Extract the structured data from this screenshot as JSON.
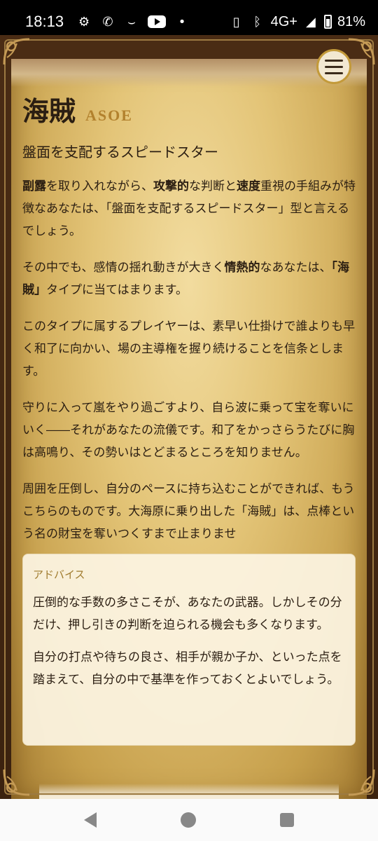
{
  "status_bar": {
    "time": "18:13",
    "network": "4G+",
    "battery": "81%",
    "battery_level": 0.81,
    "left_icons": [
      "gear-icon",
      "phone-wifi-icon",
      "amazon-icon",
      "youtube-icon",
      "dot-icon"
    ],
    "right_icons": [
      "nfc-icon",
      "bluetooth-icon",
      "signal-icon",
      "battery-icon"
    ]
  },
  "colors": {
    "frame": "#3b220f",
    "parchment": "#e3c477",
    "accent_gold": "#b2812d",
    "text": "#2b1e12",
    "advice_bg": "#fcf4e2"
  },
  "header": {
    "title": "海賊",
    "title_en": "ASOE",
    "tagline": "盤面を支配するスピードスター",
    "menu_icon": "hamburger-menu-icon"
  },
  "paragraphs": [
    [
      {
        "text": "副露",
        "bold": true
      },
      {
        "text": "を取り入れながら、",
        "bold": false
      },
      {
        "text": "攻撃的",
        "bold": true
      },
      {
        "text": "な判断と",
        "bold": false
      },
      {
        "text": "速度",
        "bold": true
      },
      {
        "text": "重視の手組みが特徴なあなたは、「盤面を支配するスピードスター」型と言えるでしょう。",
        "bold": false
      }
    ],
    [
      {
        "text": "その中でも、感情の揺れ動きが大きく",
        "bold": false
      },
      {
        "text": "情熱的",
        "bold": true
      },
      {
        "text": "なあなたは、",
        "bold": false
      },
      {
        "text": "「海賊」",
        "bold": true
      },
      {
        "text": "タイプに当てはまります。",
        "bold": false
      }
    ],
    [
      {
        "text": "このタイプに属するプレイヤーは、素早い仕掛けで誰よりも早く和了に向かい、場の主導権を握り続けることを信条とします。",
        "bold": false
      }
    ],
    [
      {
        "text": "守りに入って嵐をやり過ごすより、自ら波に乗って宝を奪いにいく――それがあなたの流儀です。和了をかっさらうたびに胸は高鳴り、その勢いはとどまるところを知りません。",
        "bold": false
      }
    ],
    [
      {
        "text": "周囲を圧倒し、自分のペースに持ち込むことができれば、もうこちらのものです。大海原に乗り出した「海賊」は、点棒という名の財宝を奪いつくすまで止まりませ",
        "bold": false
      }
    ]
  ],
  "advice": {
    "label": "アドバイス",
    "paragraphs": [
      "圧倒的な手数の多さこそが、あなたの武器。しかしその分だけ、押し引きの判断を迫られる機会も多くなります。",
      "自分の打点や待ちの良さ、相手が親か子か、といった点を踏まえて、自分の中で基準を作っておくとよいでしょう。"
    ]
  },
  "nav_bar": {
    "icons": [
      "back-icon",
      "home-icon",
      "recent-apps-icon"
    ]
  }
}
